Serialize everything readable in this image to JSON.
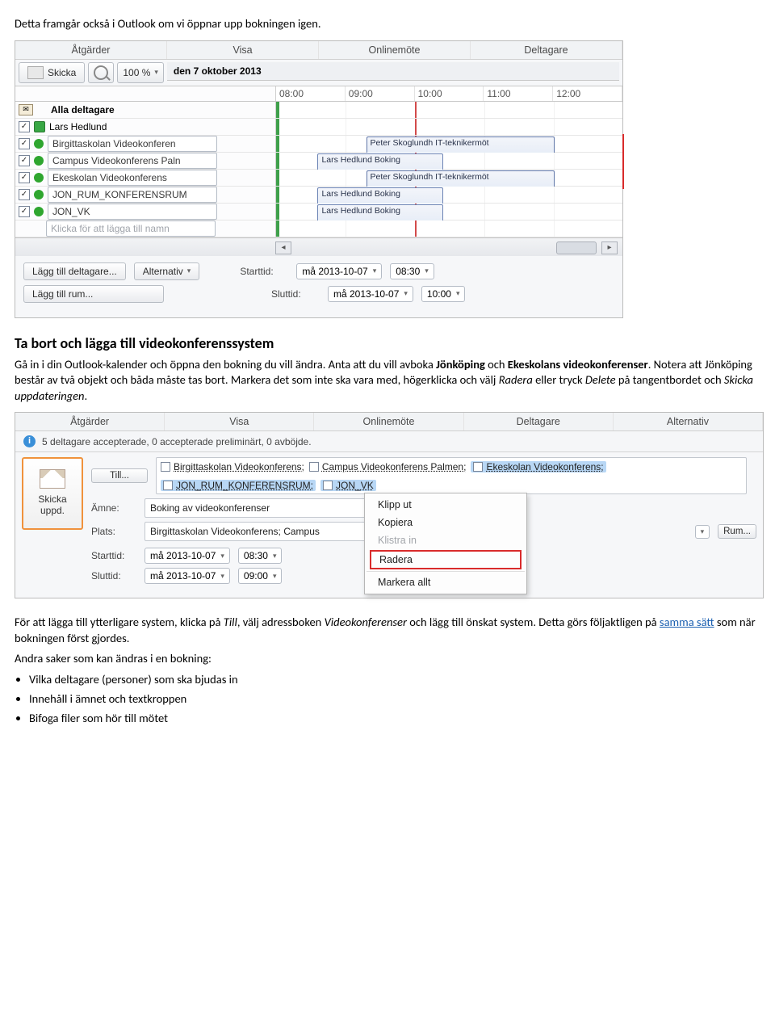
{
  "doc": {
    "intro": "Detta framgår också i Outlook om vi öppnar upp bokningen igen.",
    "heading2": "Ta bort och lägga till videokonferenssystem",
    "para2a": "Gå in i din Outlook-kalender och öppna den bokning du vill ändra. Anta att du vill avboka ",
    "para2a_bold1": "Jönköping",
    "para2a_mid": " och ",
    "para2a_bold2": "Ekeskolans videokonferenser",
    "para2a_end": ". Notera att Jönköping består av två objekt och båda måste tas bort. Markera det som inte ska vara med, högerklicka och välj ",
    "para2a_i1": "Radera",
    "para2a_after_i1": " eller tryck ",
    "para2a_i2": "Delete",
    "para2a_after_i2": " på tangentbordet och ",
    "para2a_i3": "Skicka uppdateringen",
    "para2a_dot": ".",
    "para3a": "För att lägga till ytterligare system, klicka på ",
    "para3_i1": "Till",
    "para3_mid": ", välj adressboken ",
    "para3_i2": "Videokonferenser",
    "para3_mid2": " och lägg till önskat system. Detta görs följaktligen på ",
    "para3_link": "samma sätt",
    "para3_end": " som när bokningen först gjordes.",
    "para4": "Andra saker som kan ändras i en bokning:",
    "bullets": [
      "Vilka deltagare (personer) som ska bjudas in",
      "Innehåll i ämnet och textkroppen",
      "Bifoga filer som hör till mötet"
    ]
  },
  "ss1": {
    "tabs": [
      "Åtgärder",
      "Visa",
      "Onlinemöte",
      "Deltagare"
    ],
    "skicka": "Skicka",
    "zoom": "100 %",
    "dateheader": "den 7 oktober 2013",
    "hours": [
      "08:00",
      "09:00",
      "10:00",
      "11:00",
      "12:00"
    ],
    "rows": [
      {
        "labelAll": "Alla deltagare"
      },
      {
        "name": "Lars Hedlund",
        "square": true,
        "check": true
      },
      {
        "name": "Birgittaskolan Videokonferen",
        "check": true
      },
      {
        "name": "Campus Videokonferens Paln",
        "check": true
      },
      {
        "name": "Ekeskolan Videokonferens",
        "check": true
      },
      {
        "name": "JON_RUM_KONFERENSRUM",
        "check": true
      },
      {
        "name": "JON_VK",
        "check": true
      }
    ],
    "addPlaceholder": "Klicka för att lägga till namn",
    "appts": {
      "peter": "Peter Skoglundh IT-teknikermöt",
      "lars": "Lars Hedlund Boking"
    },
    "addParticipant": "Lägg till deltagare...",
    "alternativ": "Alternativ",
    "addRoom": "Lägg till rum...",
    "starttidLabel": "Starttid:",
    "sluttidLabel": "Sluttid:",
    "date": "må 2013-10-07",
    "startTime": "08:30",
    "endTime": "10:00"
  },
  "ss2": {
    "tabs": [
      "Åtgärder",
      "Visa",
      "Onlinemöte",
      "Deltagare",
      "Alternativ"
    ],
    "infobar": "5 deltagare accepterade, 0 accepterade preliminärt, 0 avböjde.",
    "send": "Skicka uppd.",
    "till": "Till...",
    "recipients": [
      "Birgittaskolan Videokonferens;",
      "Campus Videokonferens Palmen;",
      "Ekeskolan Videokonferens;",
      "JON_RUM_KONFERENSRUM;",
      "JON_VK"
    ],
    "amneLabel": "Ämne:",
    "amneVal": "Boking av videokonferenser",
    "platsLabel": "Plats:",
    "platsVal": "Birgittaskolan Videokonferens; Campus",
    "rumBtn": "Rum...",
    "starttidLabel": "Starttid:",
    "sluttidLabel": "Sluttid:",
    "date": "må 2013-10-07",
    "startTime": "08:30",
    "endTime": "09:00",
    "menu": [
      "Klipp ut",
      "Kopiera",
      "Klistra in",
      "Radera",
      "Markera allt"
    ]
  }
}
